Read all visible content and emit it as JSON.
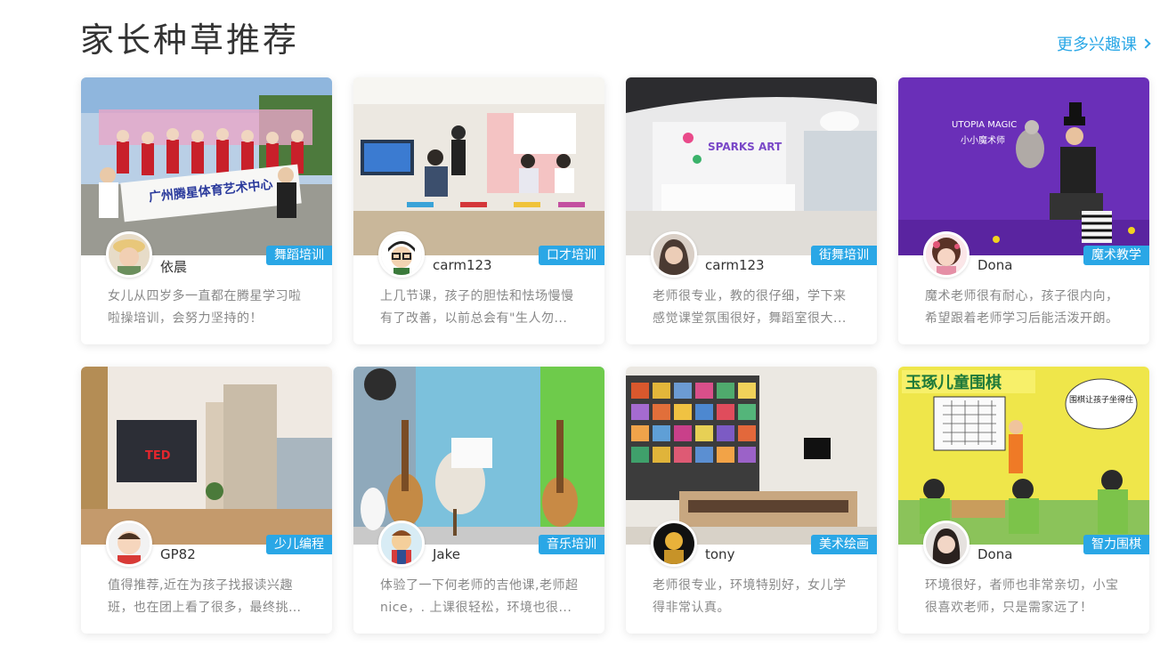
{
  "header": {
    "title": "家长种草推荐",
    "more_label": "更多兴趣课"
  },
  "colors": {
    "accent": "#2aa7e6",
    "title_text": "#333333",
    "desc_text": "#888888"
  },
  "cards": [
    {
      "tag": "舞蹈培训",
      "user": "依晨",
      "review": "女儿从四岁多一直都在腾星学习啦啦操培训，会努力坚持的！",
      "image_text": "广州腾星体育艺术中心"
    },
    {
      "tag": "口才培训",
      "user": "carm123",
      "review": "上几节课，孩子的胆怯和怯场慢慢有了改善，以前总会有\"生人勿..."
    },
    {
      "tag": "街舞培训",
      "user": "carm123",
      "review": "老师很专业，教的很仔细，学下来感觉课堂氛围很好，舞蹈室很大...",
      "image_text": "SPARKS ART"
    },
    {
      "tag": "魔术教学",
      "user": "Dona",
      "review": "魔术老师很有耐心，孩子很内向，希望跟着老师学习后能活泼开朗。",
      "image_text": "UTOPIA MAGIC",
      "image_subtext": "小小魔术师"
    },
    {
      "tag": "少儿编程",
      "user": "GP82",
      "review": "值得推荐,近在为孩子找报读兴趣班，也在团上看了很多，最终挑选到...",
      "image_text": "TED"
    },
    {
      "tag": "音乐培训",
      "user": "Jake",
      "review": "体验了一下何老师的吉他课,老师超nice，. 上课很轻松，环境也很..."
    },
    {
      "tag": "美术绘画",
      "user": "tony",
      "review": "老师很专业，环境特别好，女儿学得非常认真。"
    },
    {
      "tag": "智力围棋",
      "user": "Dona",
      "review": "环境很好，者师也非常亲切，小宝很喜欢老师，只是需家远了！",
      "image_text": "玉琢儿童围棋",
      "image_subtext": "围棋让孩子坐得住"
    }
  ]
}
